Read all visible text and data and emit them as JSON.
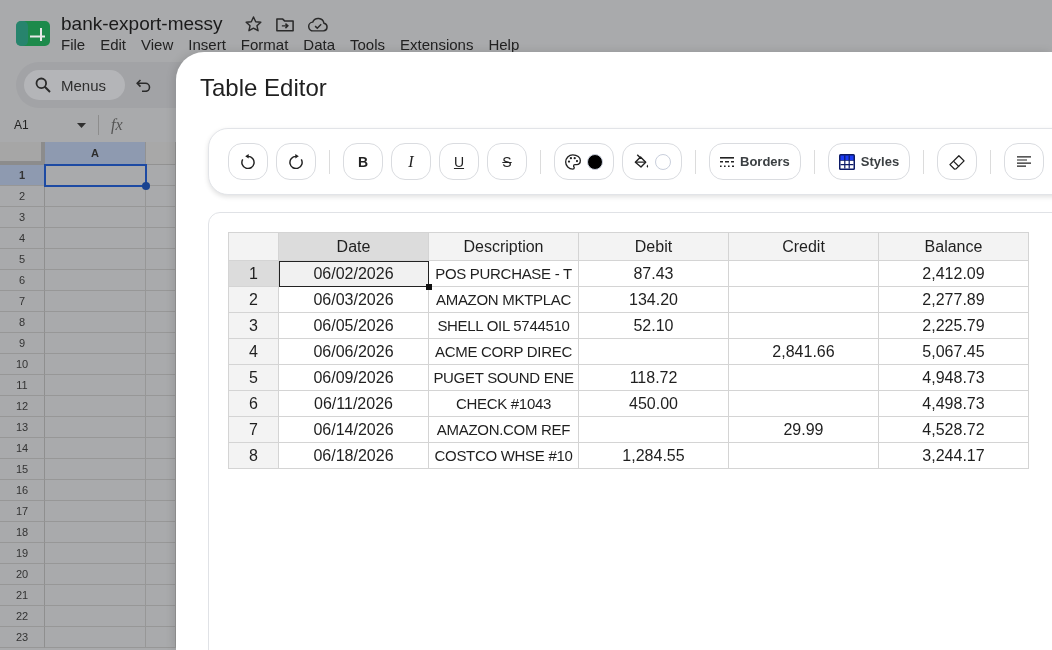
{
  "document": {
    "title": "bank-export-messy"
  },
  "menu": [
    "File",
    "Edit",
    "View",
    "Insert",
    "Format",
    "Data",
    "Tools",
    "Extensions",
    "Help"
  ],
  "search": {
    "placeholder": "Menus"
  },
  "name_box": {
    "value": "A1"
  },
  "formula_bar": {
    "label": "fx"
  },
  "sheet": {
    "columns": [
      {
        "label": "A",
        "selected": true
      }
    ],
    "rows": [
      {
        "number": "1",
        "selected": true
      },
      {
        "number": "2",
        "selected": false
      },
      {
        "number": "3",
        "selected": false
      },
      {
        "number": "4",
        "selected": false
      },
      {
        "number": "5",
        "selected": false
      },
      {
        "number": "6",
        "selected": false
      },
      {
        "number": "7",
        "selected": false
      },
      {
        "number": "8",
        "selected": false
      },
      {
        "number": "9",
        "selected": false
      },
      {
        "number": "10",
        "selected": false
      },
      {
        "number": "11",
        "selected": false
      },
      {
        "number": "12",
        "selected": false
      },
      {
        "number": "13",
        "selected": false
      },
      {
        "number": "14",
        "selected": false
      },
      {
        "number": "15",
        "selected": false
      },
      {
        "number": "16",
        "selected": false
      },
      {
        "number": "17",
        "selected": false
      },
      {
        "number": "18",
        "selected": false
      },
      {
        "number": "19",
        "selected": false
      },
      {
        "number": "20",
        "selected": false
      },
      {
        "number": "21",
        "selected": false
      },
      {
        "number": "22",
        "selected": false
      },
      {
        "number": "23",
        "selected": false
      }
    ]
  },
  "table_editor": {
    "title": "Table Editor",
    "toolbar": {
      "format_buttons": [
        {
          "kind": "bold",
          "glyph": "B"
        },
        {
          "kind": "italic",
          "glyph": "I"
        },
        {
          "kind": "underline",
          "glyph": "U"
        },
        {
          "kind": "strikethrough",
          "glyph": "S"
        }
      ],
      "color_buttons": [
        {
          "kind": "text",
          "color": "#000000"
        },
        {
          "kind": "fill",
          "color": "#ffffff"
        }
      ],
      "borders_button": {
        "label": "Borders"
      },
      "styles_button": {
        "label": "Styles"
      }
    },
    "table": {
      "columns": [
        {
          "label": "Date",
          "selected": true
        },
        {
          "label": "Description",
          "selected": false
        },
        {
          "label": "Debit",
          "selected": false
        },
        {
          "label": "Credit",
          "selected": false
        },
        {
          "label": "Balance",
          "selected": false
        }
      ],
      "rows": [
        {
          "number": "1",
          "selected": true,
          "date": "06/02/2026",
          "description": "POS PURCHASE - T",
          "debit": "87.43",
          "balance": "2,412.09"
        },
        {
          "number": "2",
          "selected": false,
          "date": "06/03/2026",
          "description": "AMAZON MKTPLAC",
          "debit": "134.20",
          "balance": "2,277.89"
        },
        {
          "number": "3",
          "selected": false,
          "date": "06/05/2026",
          "description": "SHELL OIL 5744510",
          "debit": "52.10",
          "balance": "2,225.79"
        },
        {
          "number": "4",
          "selected": false,
          "date": "06/06/2026",
          "description": "ACME CORP DIREC",
          "credit": "2,841.66",
          "balance": "5,067.45"
        },
        {
          "number": "5",
          "selected": false,
          "date": "06/09/2026",
          "description": "PUGET SOUND ENE",
          "debit": "118.72",
          "balance": "4,948.73"
        },
        {
          "number": "6",
          "selected": false,
          "date": "06/11/2026",
          "description": "CHECK #1043",
          "debit": "450.00",
          "balance": "4,498.73"
        },
        {
          "number": "7",
          "selected": false,
          "date": "06/14/2026",
          "description": "AMAZON.COM REF",
          "credit": "29.99",
          "balance": "4,528.72"
        },
        {
          "number": "8",
          "selected": false,
          "date": "06/18/2026",
          "description": "COSTCO WHSE #10",
          "debit": "1,284.55",
          "balance": "3,244.17"
        }
      ]
    }
  }
}
